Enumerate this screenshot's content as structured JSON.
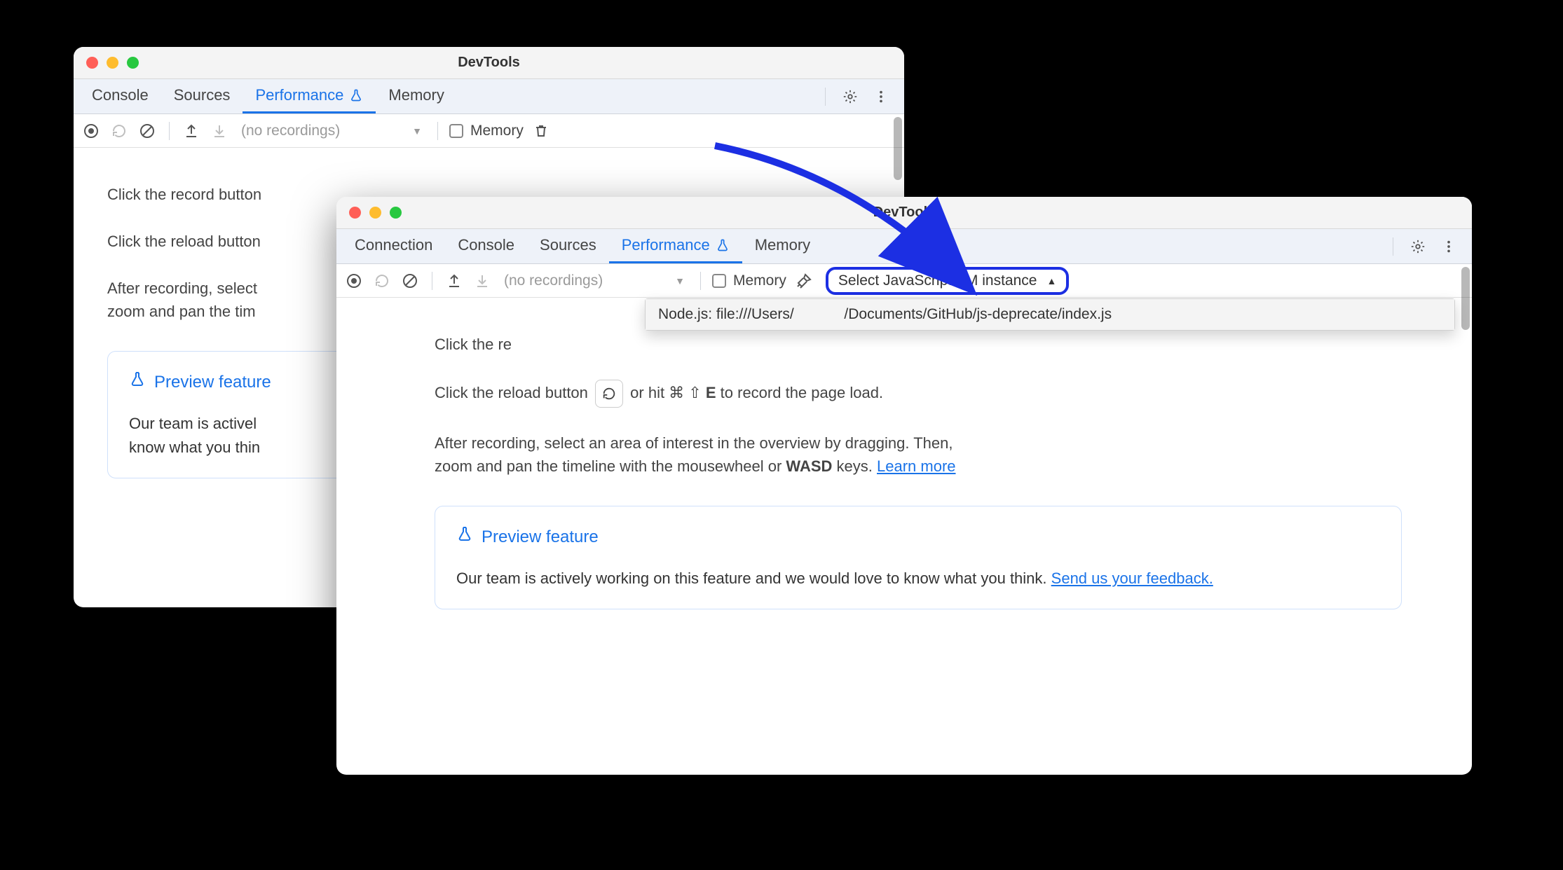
{
  "window1": {
    "title": "DevTools",
    "tabs": {
      "console": "Console",
      "sources": "Sources",
      "performance": "Performance",
      "memory": "Memory"
    },
    "toolbar": {
      "no_recordings": "(no recordings)",
      "memory_label": "Memory"
    },
    "hints": {
      "record_prefix": "Click the record button",
      "reload_prefix": "Click the reload button",
      "after_text_a": "After recording, select",
      "after_text_b": "zoom and pan the tim"
    },
    "preview": {
      "title": "Preview feature",
      "body_a": "Our team is activel",
      "body_b": "know what you thin"
    }
  },
  "window2": {
    "title": "DevTools",
    "tabs": {
      "connection": "Connection",
      "console": "Console",
      "sources": "Sources",
      "performance": "Performance",
      "memory": "Memory"
    },
    "toolbar": {
      "no_recordings": "(no recordings)",
      "memory_label": "Memory",
      "vm_select_label": "Select JavaScript VM instance"
    },
    "vm_dropdown": {
      "item_prefix": "Node.js: file:///Users/",
      "item_suffix": "/Documents/GitHub/js-deprecate/index.js"
    },
    "hints": {
      "record_prefix": "Click the re",
      "reload_prefix": "Click the reload button",
      "reload_suffix_a": "or hit ⌘ ⇧ ",
      "reload_key": "E",
      "reload_suffix_b": " to record the page load.",
      "after_text_a": "After recording, select an area of interest in the overview by dragging. Then,",
      "after_text_b": "zoom and pan the timeline with the mousewheel or ",
      "wasd": "WASD",
      "after_text_c": " keys. ",
      "learn_more": "Learn more"
    },
    "preview": {
      "title": "Preview feature",
      "body_a": "Our team is actively working on this feature and we would love to know what you think. ",
      "feedback": "Send us your feedback."
    }
  }
}
